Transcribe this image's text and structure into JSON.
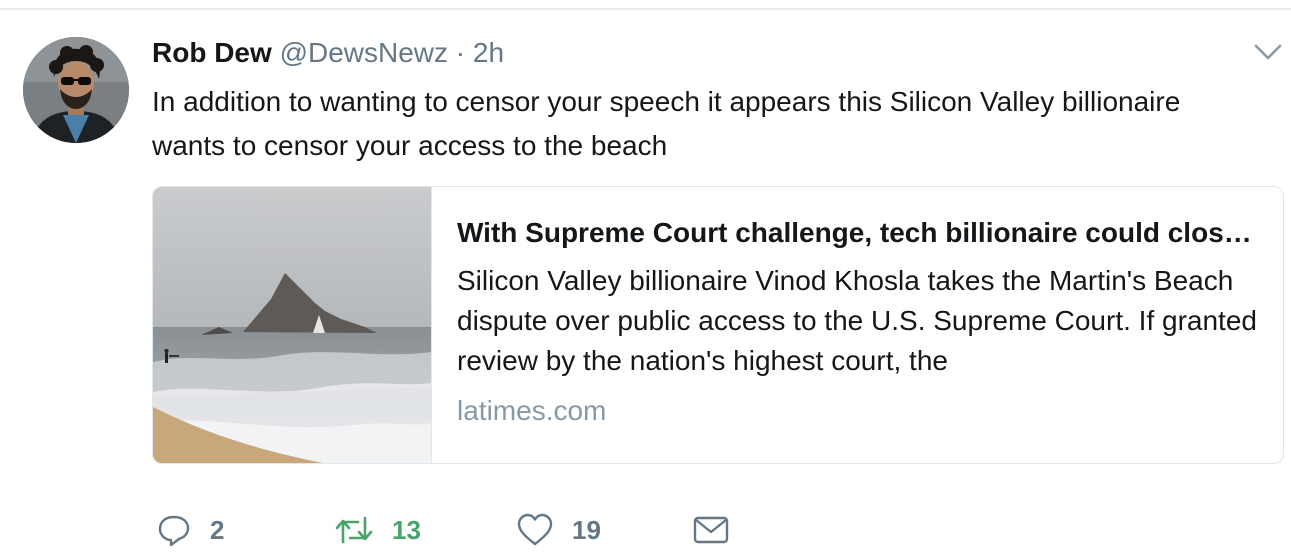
{
  "tweet": {
    "fullname": "Rob Dew",
    "username": "@DewsNewz",
    "separator": "·",
    "timestamp": "2h",
    "text": "In addition to wanting to censor your speech it appears this Silicon Valley billionaire wants to censor your access to the beach"
  },
  "card": {
    "title": "With Supreme Court challenge, tech billionaire could close off California beach",
    "description": "Silicon Valley billionaire Vinod Khosla takes the Martin's Beach dispute over public access to the U.S. Supreme Court. If granted review by the nation's highest court, the",
    "domain": "latimes.com"
  },
  "actions": {
    "reply_count": "2",
    "retweet_count": "13",
    "like_count": "19"
  },
  "icons": {
    "avatar": "avatar-icon",
    "caret": "chevron-down-icon",
    "reply": "reply-icon",
    "retweet": "retweet-icon",
    "like": "heart-icon",
    "dm": "envelope-icon"
  },
  "colors": {
    "text": "#14171a",
    "secondary": "#657786",
    "retweet_active": "#4aa36c",
    "card_border": "#e1e8ed",
    "domain": "#8899a6"
  }
}
